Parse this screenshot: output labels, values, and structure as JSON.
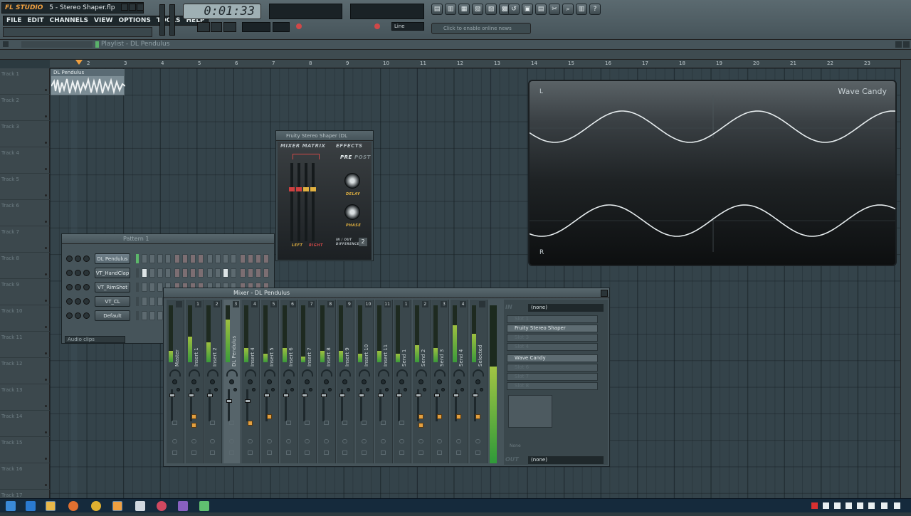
{
  "app": {
    "logo": "FL STUDIO",
    "project_file": "5 - Stereo Shaper.flp",
    "menu": [
      "FILE",
      "EDIT",
      "CHANNELS",
      "VIEW",
      "OPTIONS",
      "TOOLS",
      "HELP"
    ],
    "time_display": "0:01:33",
    "tempo_mode": "Line",
    "online_prompt": "Click to enable online news",
    "toolbar_icons": [
      "playlist-icon",
      "piano-roll-icon",
      "channel-rack-icon",
      "mixer-icon",
      "browser-icon",
      "plugin-picker-icon"
    ]
  },
  "playlist": {
    "title": "Playlist - DL Pendulus",
    "ruler": [
      "1",
      "2",
      "3",
      "4",
      "5",
      "6",
      "7",
      "8",
      "9",
      "10",
      "11",
      "12",
      "13",
      "14",
      "15",
      "16",
      "17",
      "18",
      "19",
      "20",
      "21",
      "22",
      "23"
    ],
    "tracks": [
      "Track 1",
      "Track 2",
      "Track 3",
      "Track 4",
      "Track 5",
      "Track 6",
      "Track 7",
      "Track 8",
      "Track 9",
      "Track 10",
      "Track 11",
      "Track 12",
      "Track 13",
      "Track 14",
      "Track 15",
      "Track 16",
      "Track 17"
    ],
    "clip": {
      "name": "DL Pendulus",
      "track": 1
    }
  },
  "pattern": {
    "title": "Pattern 1",
    "channels": [
      "DL Pendulus",
      "VT_HandClap",
      "VT_RimShot",
      "VT_CL",
      "Default"
    ],
    "filter": "Audio clips"
  },
  "stereo_shaper": {
    "title": "Fruity Stereo Shaper (DL",
    "mixer_matrix": "MIXER MATRIX",
    "effects": "EFFECTS",
    "pre": "PRE",
    "post": "POST",
    "delay": "DELAY",
    "phase": "PHASE",
    "left": "LEFT",
    "right": "RIGHT",
    "inout": "IN / OUT DIFFERENCE"
  },
  "mixer": {
    "title": "Mixer - DL Pendulus",
    "strips": [
      "Master",
      "Insert 1",
      "Insert 2",
      "DL Pendulus",
      "Insert 4",
      "Insert 5",
      "Insert 6",
      "Insert 7",
      "Insert 8",
      "Insert 9",
      "Insert 10",
      "Insert 11",
      "Send 1",
      "Send 2",
      "Send 3",
      "Send 4",
      "Selected"
    ],
    "strip_numbers": [
      "",
      "1",
      "2",
      "3",
      "4",
      "5",
      "6",
      "7",
      "8",
      "9",
      "10",
      "11",
      "1",
      "2",
      "3",
      "4",
      ""
    ],
    "in_label": "IN",
    "in_value": "(none)",
    "out_label": "OUT",
    "out_value": "(none)",
    "fx_slots": [
      "Slot 1",
      "Fruity Stereo Shaper",
      "Slot 3",
      "Slot 4",
      "Wave Candy",
      "Slot 6",
      "Slot 7",
      "Slot 8"
    ],
    "eq_label": "None"
  },
  "wave_candy": {
    "title": "Wave Candy",
    "left": "L",
    "right": "R"
  }
}
